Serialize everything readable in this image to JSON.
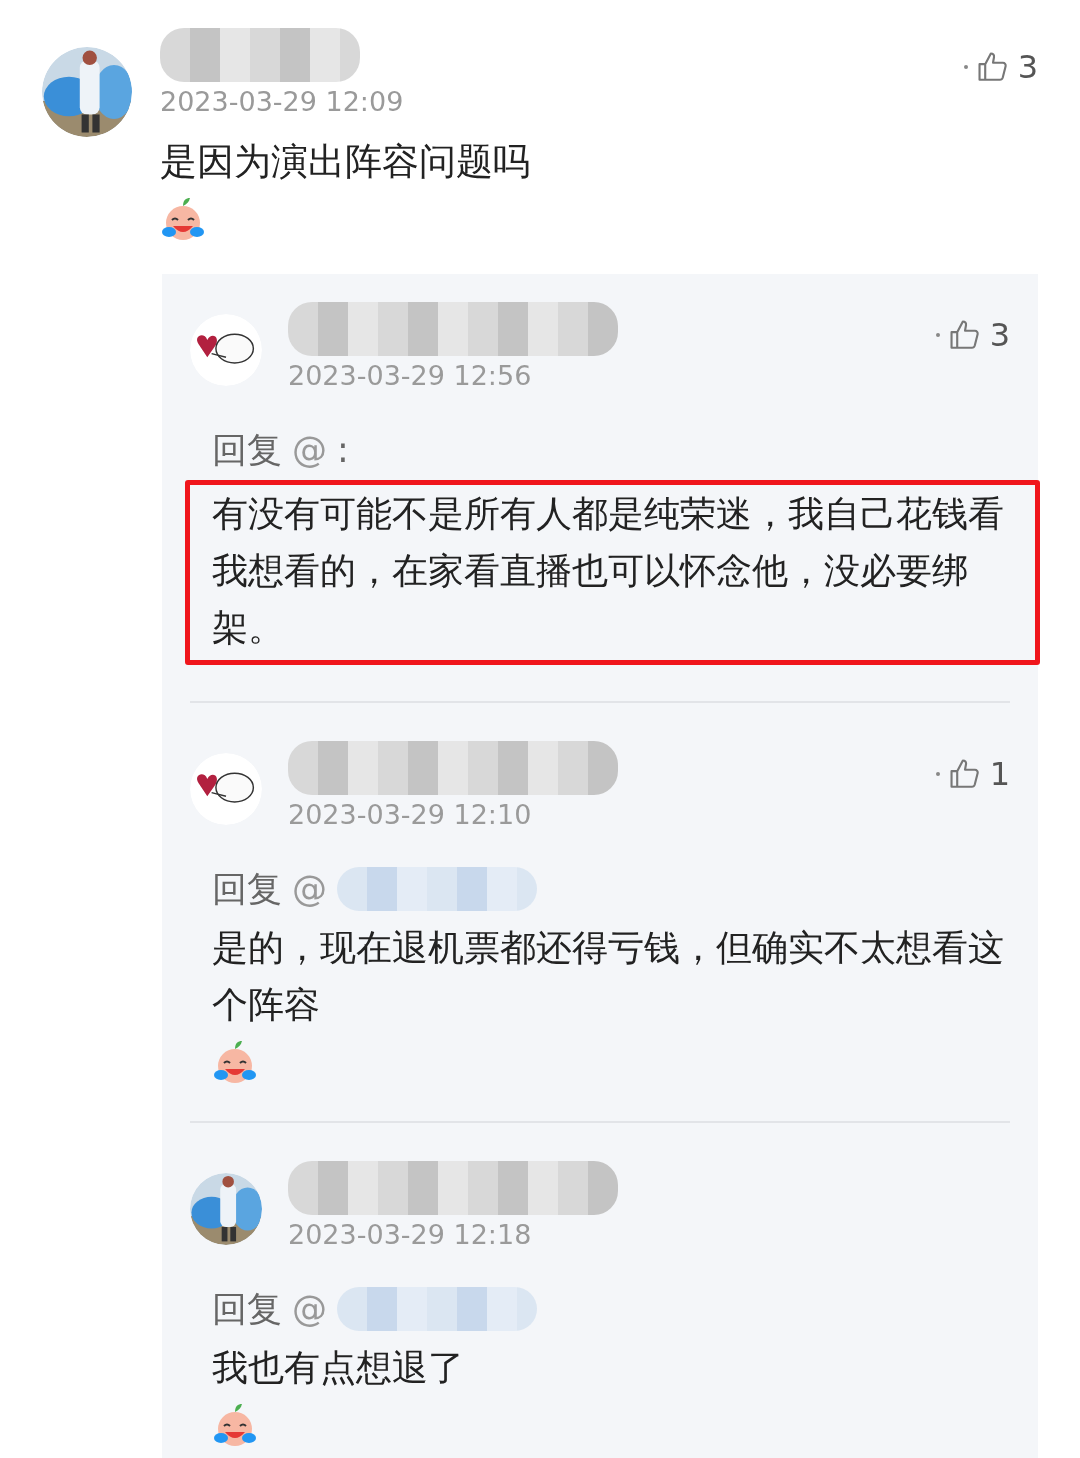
{
  "comment": {
    "time": "2023-03-29 12:09",
    "likes": "3",
    "text": "是因为演出阵容问题吗",
    "emoji": true
  },
  "replies": [
    {
      "time": "2023-03-29 12:56",
      "likes": "3",
      "reply_label": "回复",
      "mention": "@",
      "mention_hidden": false,
      "mention_suffix": ":",
      "text": "有没有可能不是所有人都是纯荣迷，我自己花钱看我想看的，在家看直播也可以怀念他，没必要绑架。",
      "highlighted": true,
      "emoji": false
    },
    {
      "time": "2023-03-29 12:10",
      "likes": "1",
      "reply_label": "回复",
      "mention": "@",
      "mention_hidden": true,
      "text": "是的，现在退机票都还得亏钱，但确实不太想看这个阵容",
      "highlighted": false,
      "emoji": true
    },
    {
      "time": "2023-03-29 12:18",
      "reply_label": "回复",
      "mention": "@",
      "mention_hidden": true,
      "text": "我也有点想退了",
      "highlighted": false,
      "emoji": true
    }
  ]
}
